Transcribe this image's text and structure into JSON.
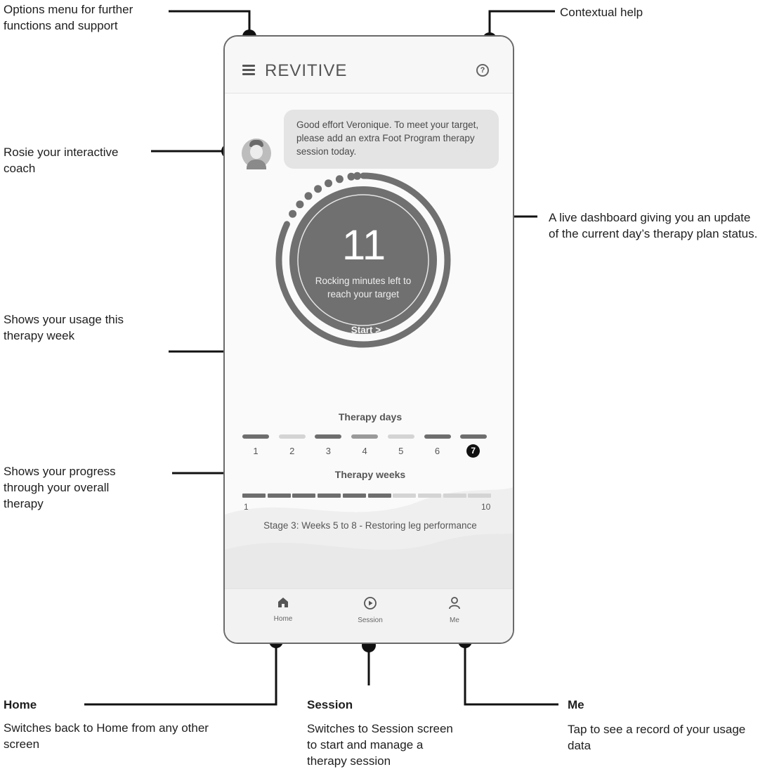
{
  "annotations": {
    "options_menu": "Options menu for further functions and support",
    "contextual_help": "Contextual help",
    "rosie": "Rosie your interactive coach",
    "dashboard": "A live dashboard giving you an update of the current day’s therapy plan status.",
    "usage_week": "Shows your usage this therapy week",
    "progress": "Shows your progress through your overall therapy",
    "home_title": "Home",
    "home_desc": "Switches back to Home from any other screen",
    "session_title": "Session",
    "session_desc": "Switches to Session screen to start and manage a therapy session",
    "me_title": "Me",
    "me_desc": "Tap to see a record of your usage data"
  },
  "app": {
    "brand": "REVITIVE",
    "menu_icon": "hamburger-menu-icon",
    "help_icon": "help-circle-icon",
    "coach_message": "Good effort Veronique. To meet your target, please add an extra Foot Program therapy session today.",
    "dashboard": {
      "minutes_left": "11",
      "caption": "Rocking minutes left to reach your target",
      "start_label": "Start >",
      "progress_fraction": 0.82
    },
    "therapy_days": {
      "title": "Therapy days",
      "days": [
        "1",
        "2",
        "3",
        "4",
        "5",
        "6",
        "7"
      ],
      "current_day": "7",
      "day_levels": [
        "dark",
        "light",
        "dark",
        "medium",
        "light",
        "dark",
        "dark"
      ]
    },
    "therapy_weeks": {
      "title": "Therapy weeks",
      "start_label": "1",
      "end_label": "10",
      "total_weeks": 10,
      "completed_weeks": 6,
      "stage_text": "Stage 3: Weeks 5 to 8 - Restoring leg performance"
    },
    "nav": [
      {
        "label": "Home",
        "icon": "home-icon"
      },
      {
        "label": "Session",
        "icon": "play-circle-icon"
      },
      {
        "label": "Me",
        "icon": "user-icon"
      }
    ]
  },
  "colors": {
    "dial_fill": "#6f6f6f",
    "dial_ring": "#6f6f6f",
    "bar_dark": "#6e6e6e",
    "bar_medium": "#9a9a9a",
    "bar_light": "#d4d4d4",
    "text_dark": "#1e1e1e"
  }
}
